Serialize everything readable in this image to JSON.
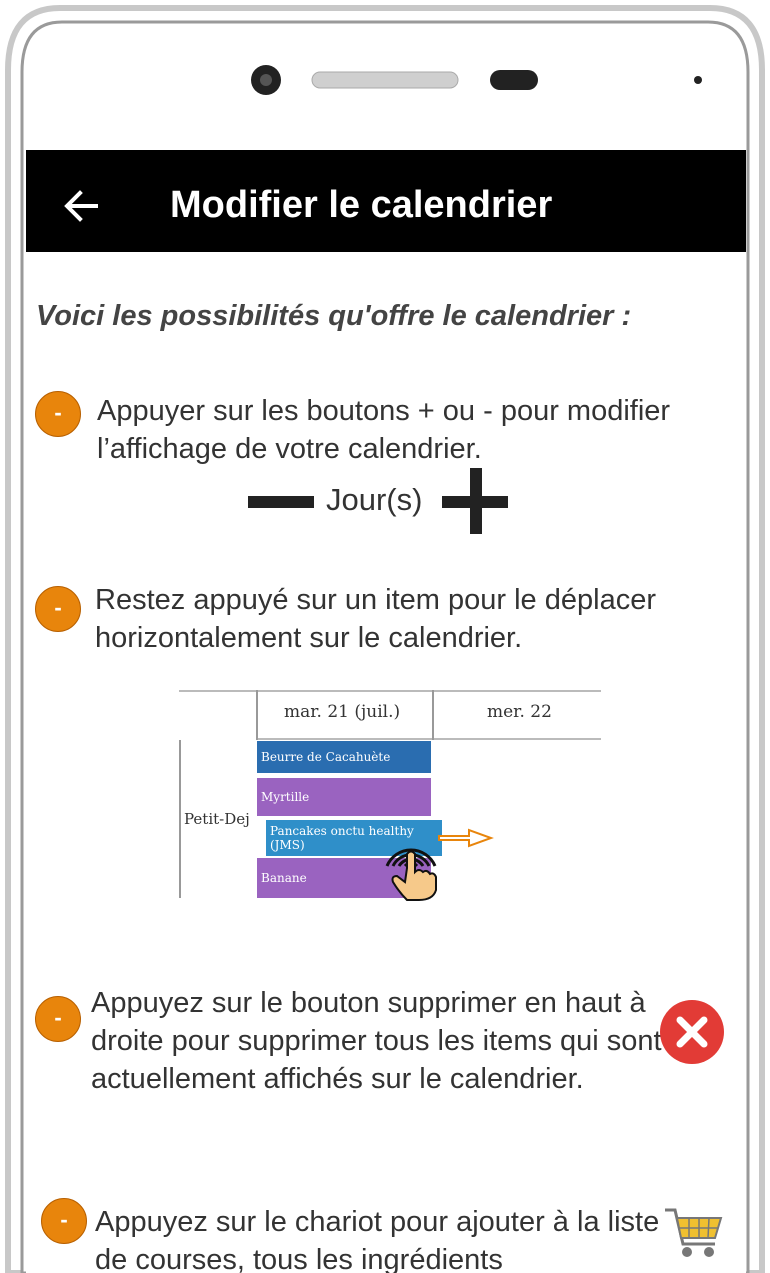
{
  "appbar": {
    "title": "Modifier le calendrier",
    "back_icon": "arrow-left-icon"
  },
  "intro": "Voici les possibilités qu'offre le calendrier :",
  "bullet_symbol": "-",
  "items": [
    {
      "text": "Appuyer sur les boutons + ou - pour modifier l’affichage de votre calendrier."
    },
    {
      "text": "Restez appuyé sur un item pour le déplacer horizontalement sur le calendrier."
    },
    {
      "text": "Appuyez sur le bouton supprimer en haut à droite pour supprimer tous les items qui sont actuellement affichés sur le calendrier."
    },
    {
      "text": "Appuyez sur le chariot pour ajouter à la liste de courses, tous les ingrédients"
    }
  ],
  "zoom": {
    "label": "Jour(s)"
  },
  "calendar": {
    "columns": [
      "mar. 21 (juil.)",
      "mer. 22"
    ],
    "row_label": "Petit-Dej",
    "items": [
      {
        "label": "Beurre de Cacahuète",
        "color": "#2a6db0"
      },
      {
        "label": "Myrtille",
        "color": "#9a63c0"
      },
      {
        "label": "Pancakes onctu healthy (JMS)",
        "color": "#2f8fc9"
      },
      {
        "label": "Banane",
        "color": "#9a63c0"
      }
    ]
  },
  "colors": {
    "bullet": "#e8850c",
    "appbar": "#000000",
    "delete": "#e23b36",
    "cart": "#e8b020"
  },
  "icons": {
    "delete": "close-circle-icon",
    "cart": "shopping-cart-icon",
    "drag": "hand-pointer-icon",
    "drag_arrow": "arrow-right-icon"
  }
}
